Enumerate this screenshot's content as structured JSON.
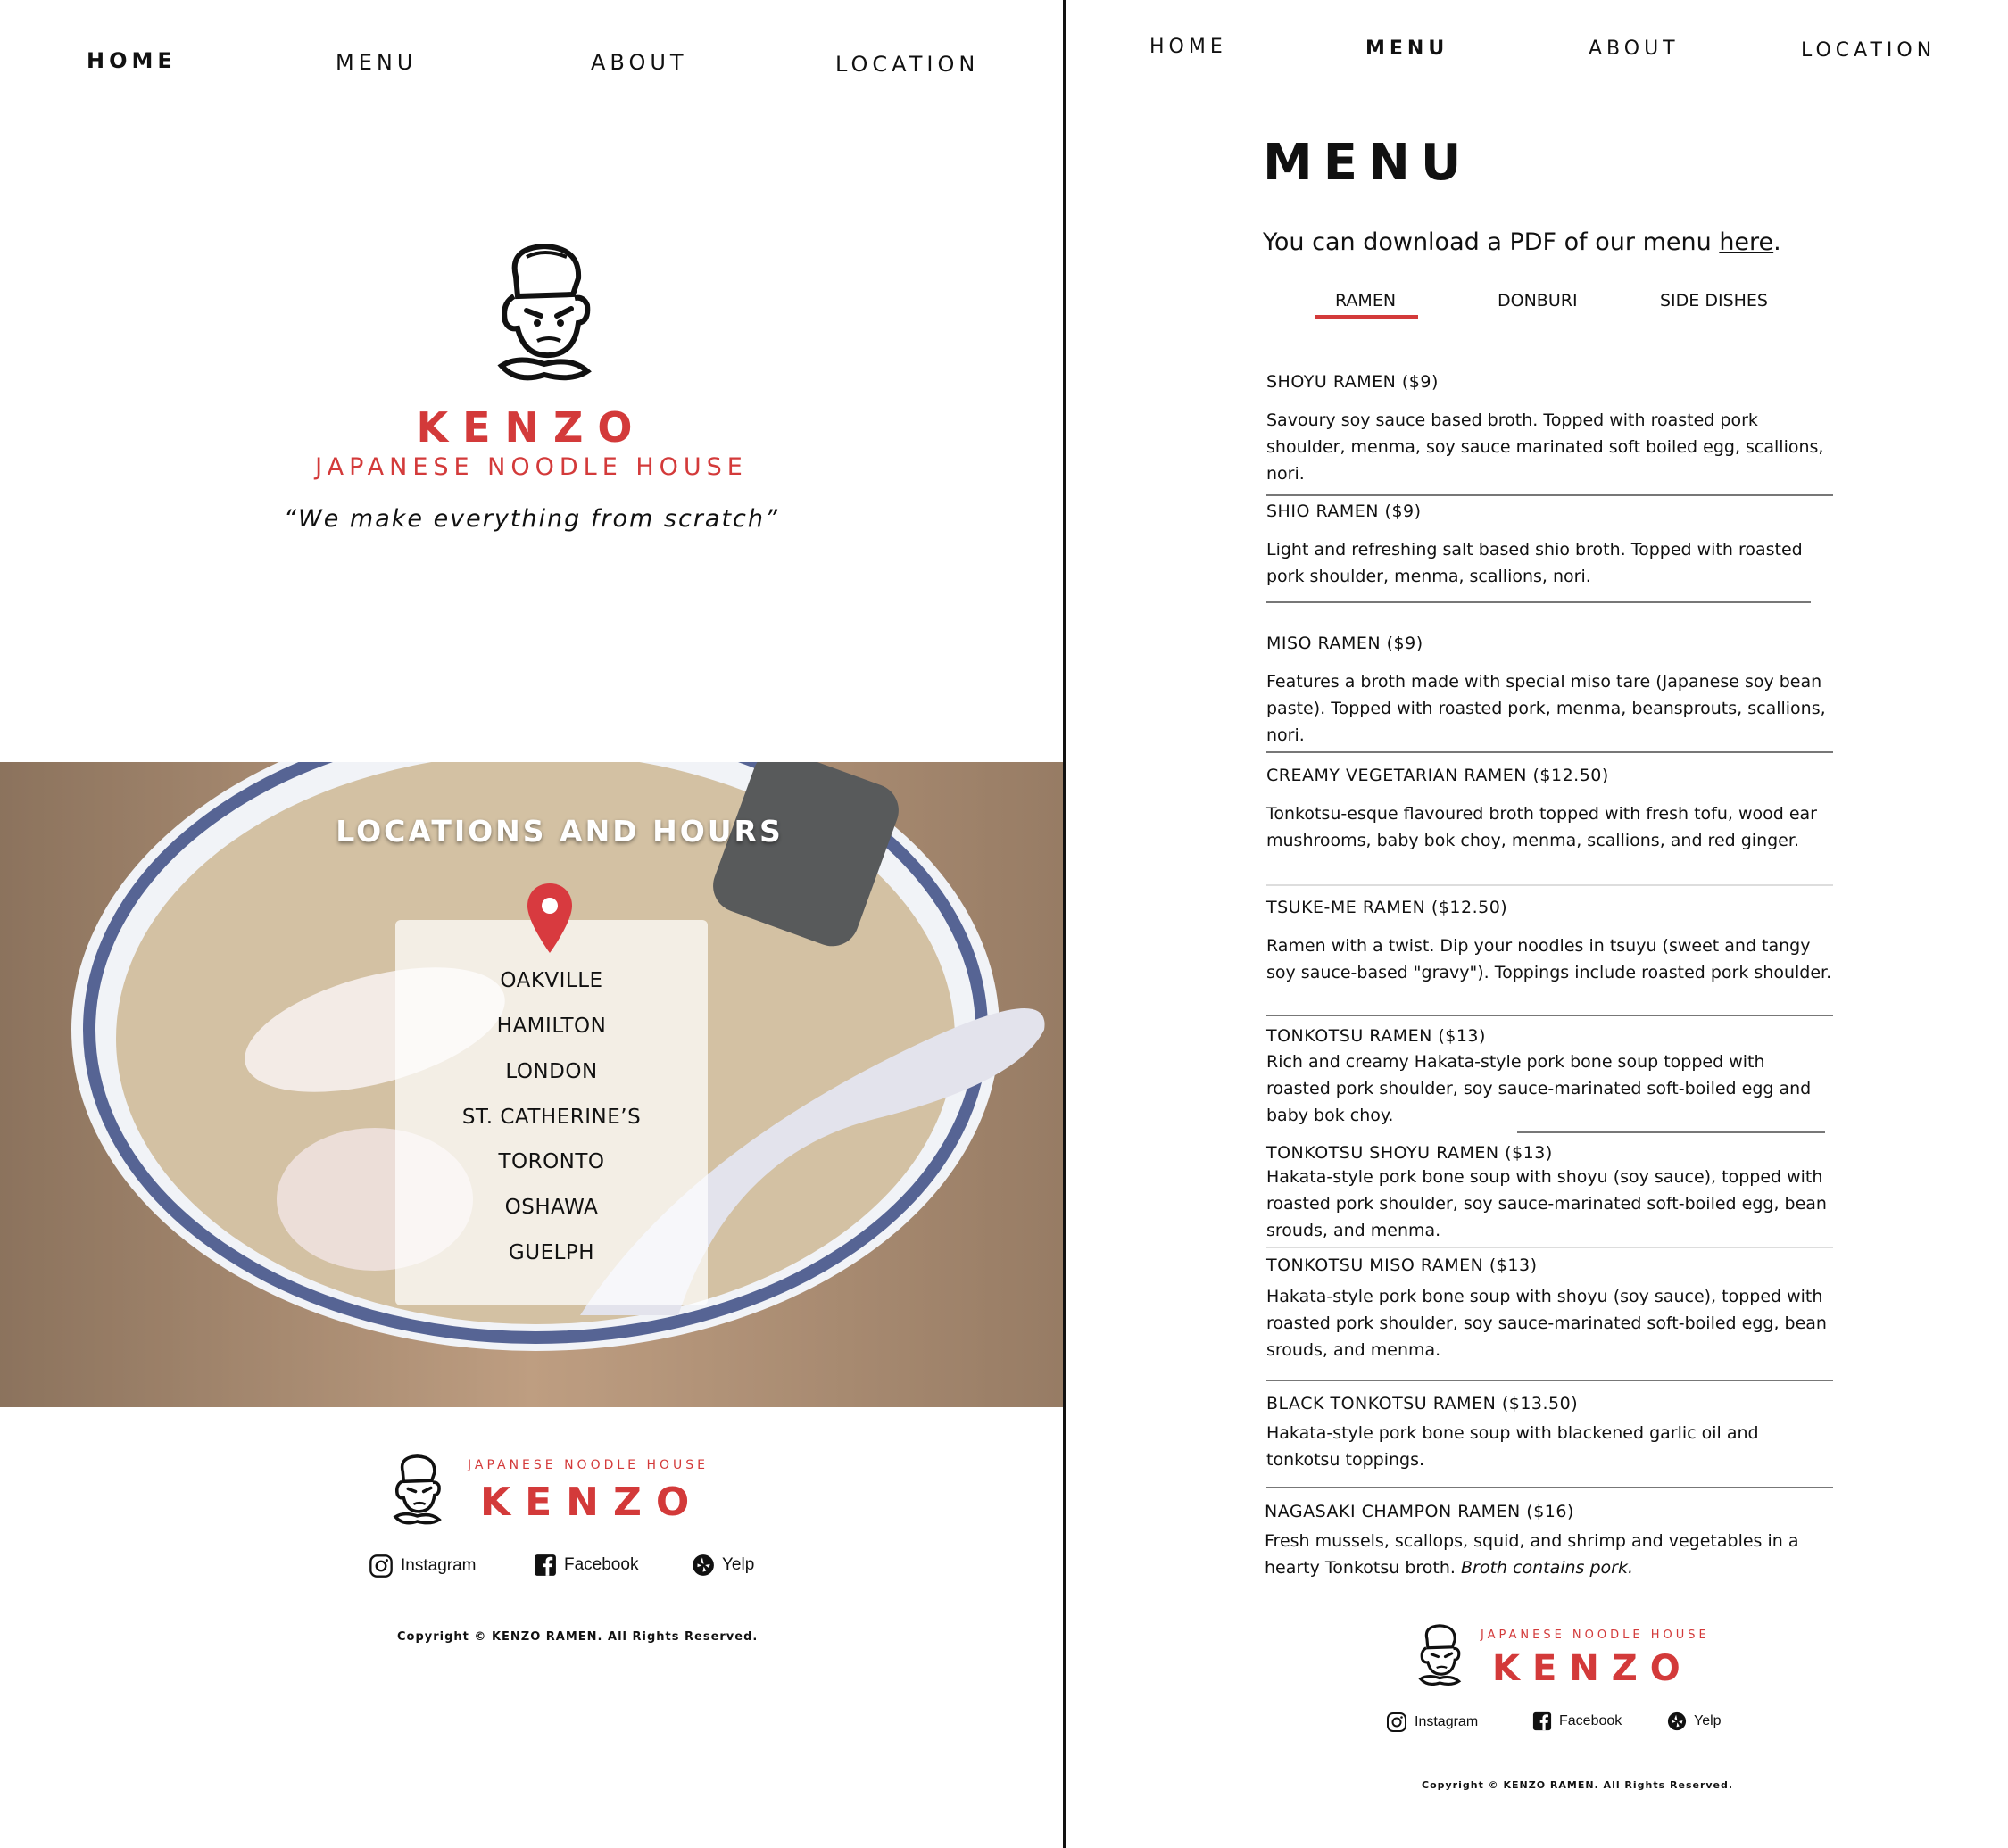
{
  "left_page": {
    "nav": {
      "home": "HOME",
      "menu": "MENU",
      "about": "ABOUT",
      "location": "LOCATION"
    },
    "brand": {
      "name": "KENZO",
      "subtitle": "JAPANESE NOODLE HOUSE",
      "tagline": "“We make everything from scratch”"
    },
    "locations": {
      "title": "LOCATIONS AND HOURS",
      "items": [
        "OAKVILLE",
        "HAMILTON",
        "LONDON",
        "ST. CATHERINE’S",
        "TORONTO",
        "OSHAWA",
        "GUELPH"
      ]
    },
    "footer": {
      "subtitle": "JAPANESE NOODLE HOUSE",
      "name": "KENZO",
      "social": {
        "instagram": "Instagram",
        "facebook": "Facebook",
        "yelp": "Yelp"
      },
      "copyright": "Copyright © KENZO RAMEN. All Rights Reserved."
    }
  },
  "right_page": {
    "nav": {
      "home": "HOME",
      "menu": "MENU",
      "about": "ABOUT",
      "location": "LOCATION"
    },
    "title": "MENU",
    "pdf_text": "You can download a PDF of our menu ",
    "pdf_link": "here",
    "pdf_period": ".",
    "tabs": {
      "ramen": "RAMEN",
      "donburi": "DONBURI",
      "side_dishes": "SIDE DISHES"
    },
    "items": [
      {
        "name": "SHOYU RAMEN ($9)",
        "desc": "Savoury soy sauce based broth. Topped with roasted pork shoulder, menma, soy sauce marinated soft boiled egg, scallions, nori."
      },
      {
        "name": "SHIO RAMEN ($9)",
        "desc": "Light and refreshing salt based shio broth. Topped with roasted pork shoulder, menma, scallions, nori."
      },
      {
        "name": "MISO RAMEN ($9)",
        "desc": "Features a broth made with special miso tare (Japanese soy bean paste). Topped with roasted pork, menma, beansprouts, scallions, nori."
      },
      {
        "name": "CREAMY VEGETARIAN RAMEN ($12.50)",
        "desc": "Tonkotsu-esque flavoured broth topped with fresh tofu, wood ear mushrooms, baby bok choy, menma, scallions, and red ginger."
      },
      {
        "name": "TSUKE-ME RAMEN ($12.50)",
        "desc": "Ramen with a twist. Dip your noodles in tsuyu (sweet and tangy soy sauce-based \"gravy\"). Toppings include roasted pork shoulder."
      },
      {
        "name": "TONKOTSU RAMEN ($13)",
        "desc": "Rich and creamy Hakata-style pork bone soup topped with roasted pork shoulder, soy sauce-marinated soft-boiled egg and baby bok choy."
      },
      {
        "name": "TONKOTSU SHOYU RAMEN ($13)",
        "desc": "Hakata-style pork bone soup with shoyu (soy sauce), topped with roasted pork shoulder, soy sauce-marinated soft-boiled egg, bean srouds, and menma."
      },
      {
        "name": "TONKOTSU MISO RAMEN ($13)",
        "desc": "Hakata-style pork bone soup with shoyu (soy sauce), topped with roasted pork shoulder, soy sauce-marinated soft-boiled egg, bean srouds, and menma."
      },
      {
        "name": "BLACK TONKOTSU RAMEN ($13.50)",
        "desc": "Hakata-style pork bone soup with blackened garlic oil and tonkotsu toppings."
      },
      {
        "name": "NAGASAKI CHAMPON RAMEN ($16)",
        "desc": "Fresh mussels, scallops, squid, and shrimp and vegetables in a hearty Tonkotsu broth. ",
        "desc_note": "Broth contains pork."
      }
    ],
    "footer": {
      "subtitle": "JAPANESE NOODLE HOUSE",
      "name": "KENZO",
      "social": {
        "instagram": "Instagram",
        "facebook": "Facebook",
        "yelp": "Yelp"
      },
      "copyright": "Copyright © KENZO RAMEN. All Rights Reserved."
    }
  },
  "colors": {
    "brand_red": "#d33a3a",
    "text": "#111111",
    "background": "#ffffff"
  },
  "icons": [
    "chef-mascot-logo",
    "map-pin-icon",
    "instagram-icon",
    "facebook-icon",
    "yelp-icon"
  ]
}
